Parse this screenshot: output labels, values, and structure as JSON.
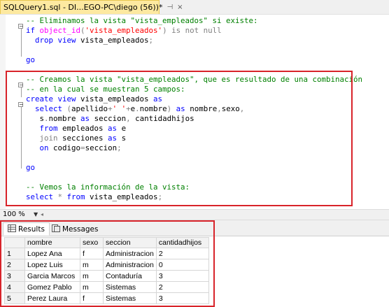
{
  "tab": {
    "title": "SQLQuery1.sql - DI...EGO-PC\\diego (56))*",
    "pin": "⊣",
    "close": "×"
  },
  "code": [
    [
      [
        "cm",
        "-- Eliminamos la vista \"vista_empleados\" si existe:"
      ]
    ],
    [
      [
        "kw",
        "if "
      ],
      [
        "fn",
        "object_id"
      ],
      [
        "gr",
        "("
      ],
      [
        "str",
        "'vista_empleados'"
      ],
      [
        "gr",
        ") "
      ],
      [
        "gr",
        "is not null"
      ]
    ],
    [
      [
        "tx",
        "  "
      ],
      [
        "kw",
        "drop view "
      ],
      [
        "tx",
        "vista_empleados"
      ],
      [
        "gr",
        ";"
      ]
    ],
    [],
    [
      [
        "kw",
        "go"
      ]
    ],
    [],
    [
      [
        "cm",
        "-- Creamos la vista \"vista_empleados\", que es resultado de una combinación"
      ]
    ],
    [
      [
        "cm",
        "-- en la cual se muestran 5 campos:"
      ]
    ],
    [
      [
        "kw",
        "create view "
      ],
      [
        "tx",
        "vista_empleados "
      ],
      [
        "kw",
        "as"
      ]
    ],
    [
      [
        "tx",
        "  "
      ],
      [
        "kw",
        "select "
      ],
      [
        "gr",
        "("
      ],
      [
        "tx",
        "apellido"
      ],
      [
        "gr",
        "+"
      ],
      [
        "str",
        "' '"
      ],
      [
        "gr",
        "+"
      ],
      [
        "tx",
        "e"
      ],
      [
        "gr",
        "."
      ],
      [
        "tx",
        "nombre"
      ],
      [
        "gr",
        ") "
      ],
      [
        "kw",
        "as "
      ],
      [
        "tx",
        "nombre"
      ],
      [
        "gr",
        ","
      ],
      [
        "tx",
        "sexo"
      ],
      [
        "gr",
        ","
      ]
    ],
    [
      [
        "tx",
        "   s"
      ],
      [
        "gr",
        "."
      ],
      [
        "tx",
        "nombre "
      ],
      [
        "kw",
        "as "
      ],
      [
        "tx",
        "seccion"
      ],
      [
        "gr",
        ", "
      ],
      [
        "tx",
        "cantidadhijos"
      ]
    ],
    [
      [
        "tx",
        "   "
      ],
      [
        "kw",
        "from "
      ],
      [
        "tx",
        "empleados "
      ],
      [
        "kw",
        "as "
      ],
      [
        "tx",
        "e"
      ]
    ],
    [
      [
        "tx",
        "   "
      ],
      [
        "gr",
        "join "
      ],
      [
        "tx",
        "secciones "
      ],
      [
        "kw",
        "as "
      ],
      [
        "tx",
        "s"
      ]
    ],
    [
      [
        "tx",
        "   "
      ],
      [
        "kw",
        "on "
      ],
      [
        "tx",
        "codigo"
      ],
      [
        "gr",
        "="
      ],
      [
        "tx",
        "seccion"
      ],
      [
        "gr",
        ";"
      ]
    ],
    [],
    [
      [
        "kw",
        "go"
      ]
    ],
    [],
    [
      [
        "cm",
        "-- Vemos la información de la vista:"
      ]
    ],
    [
      [
        "kw",
        "select "
      ],
      [
        "gr",
        "* "
      ],
      [
        "kw",
        "from "
      ],
      [
        "tx",
        "vista_empleados"
      ],
      [
        "gr",
        ";"
      ]
    ]
  ],
  "zoom": "100 %",
  "results_tabs": [
    {
      "label": "Results",
      "icon": "grid-icon"
    },
    {
      "label": "Messages",
      "icon": "messages-icon"
    }
  ],
  "table": {
    "headers": [
      "nombre",
      "sexo",
      "seccion",
      "cantidadhijos"
    ],
    "rows": [
      [
        "1",
        "Lopez Ana",
        "f",
        "Administracion",
        "2"
      ],
      [
        "2",
        "Lopez Luis",
        "m",
        "Administracion",
        "0"
      ],
      [
        "3",
        "Garcia Marcos",
        "m",
        "Contaduría",
        "3"
      ],
      [
        "4",
        "Gomez Pablo",
        "m",
        "Sistemas",
        "2"
      ],
      [
        "5",
        "Perez Laura",
        "f",
        "Sistemas",
        "3"
      ]
    ]
  },
  "colors": {
    "highlight": "#d8232a",
    "keyword": "#0000ff",
    "comment": "#008000",
    "string": "#ff0000",
    "function": "#ff00ff",
    "tab": "#fde9a0"
  }
}
